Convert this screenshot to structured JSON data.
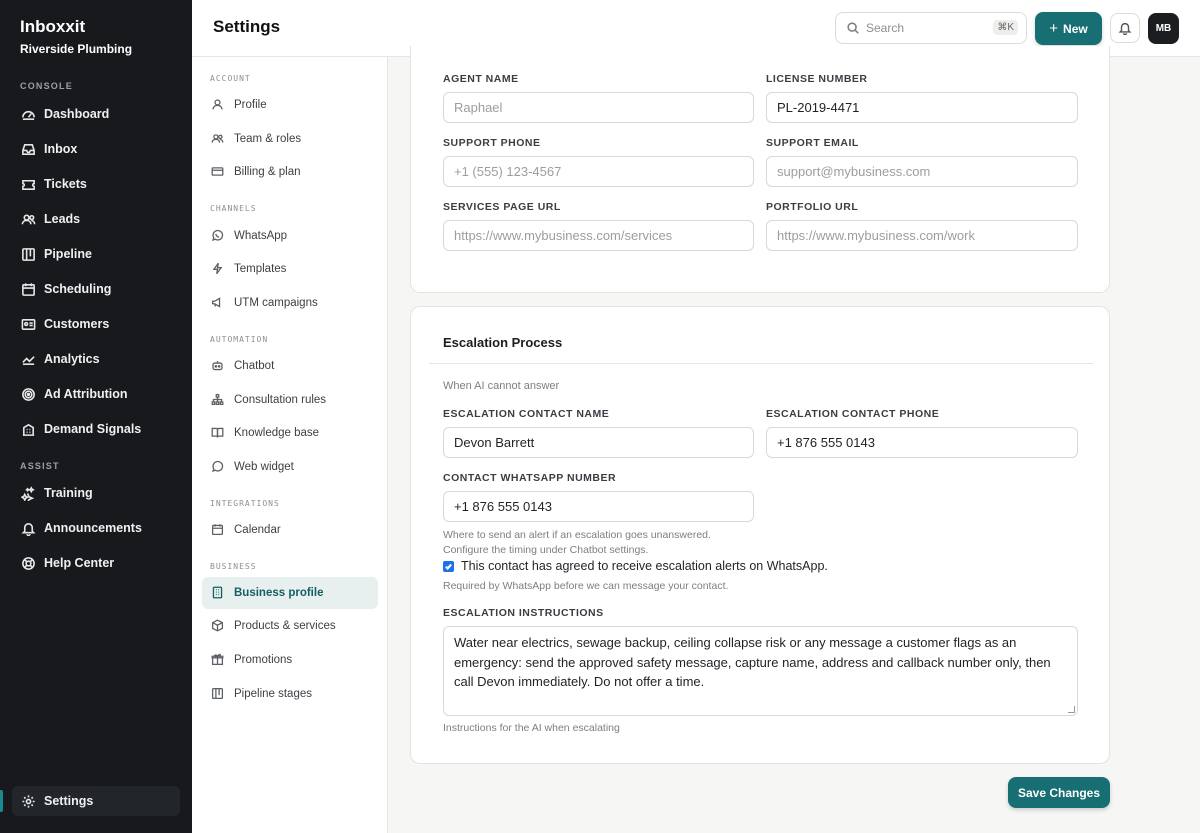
{
  "app": {
    "name": "Inboxxit",
    "workspace": "Riverside Plumbing"
  },
  "sidebar": {
    "sections": {
      "console": "CONSOLE",
      "assist": "ASSIST"
    },
    "console_items": [
      {
        "label": "Dashboard",
        "icon": "dashboard-icon"
      },
      {
        "label": "Inbox",
        "icon": "inbox-icon"
      },
      {
        "label": "Tickets",
        "icon": "ticket-icon"
      },
      {
        "label": "Leads",
        "icon": "users-icon"
      },
      {
        "label": "Pipeline",
        "icon": "pipeline-icon"
      },
      {
        "label": "Scheduling",
        "icon": "calendar-icon"
      },
      {
        "label": "Customers",
        "icon": "id-card-icon"
      },
      {
        "label": "Analytics",
        "icon": "analytics-icon"
      },
      {
        "label": "Ad Attribution",
        "icon": "target-icon"
      },
      {
        "label": "Demand Signals",
        "icon": "building-icon"
      }
    ],
    "assist_items": [
      {
        "label": "Training",
        "icon": "sparkle-icon"
      },
      {
        "label": "Announcements",
        "icon": "bell-icon"
      },
      {
        "label": "Help Center",
        "icon": "lifebuoy-icon"
      }
    ],
    "settings_label": "Settings"
  },
  "topbar": {
    "title": "Settings",
    "search_placeholder": "Search",
    "search_shortcut": "⌘K",
    "new_label": "New",
    "avatar_initials": "MB"
  },
  "settings_nav": {
    "sections": {
      "account": "ACCOUNT",
      "channels": "CHANNELS",
      "automation": "AUTOMATION",
      "integrations": "INTEGRATIONS",
      "business": "BUSINESS"
    },
    "account": [
      "Profile",
      "Team & roles",
      "Billing & plan"
    ],
    "channels": [
      "WhatsApp",
      "Templates",
      "UTM campaigns"
    ],
    "automation": [
      "Chatbot",
      "Consultation rules",
      "Knowledge base",
      "Web widget"
    ],
    "integrations": [
      "Calendar"
    ],
    "business": [
      "Business profile",
      "Products & services",
      "Promotions",
      "Pipeline stages"
    ],
    "active": "Business profile"
  },
  "profile_card": {
    "agent_name": {
      "label": "AGENT NAME",
      "value": "",
      "placeholder": "Raphael"
    },
    "license_number": {
      "label": "LICENSE NUMBER",
      "value": "PL-2019-4471"
    },
    "support_phone": {
      "label": "SUPPORT PHONE",
      "placeholder": "+1 (555) 123-4567"
    },
    "support_email": {
      "label": "SUPPORT EMAIL",
      "placeholder": "support@mybusiness.com"
    },
    "services_url": {
      "label": "SERVICES PAGE URL",
      "placeholder": "https://www.mybusiness.com/services"
    },
    "portfolio_url": {
      "label": "PORTFOLIO URL",
      "placeholder": "https://www.mybusiness.com/work"
    }
  },
  "escalation": {
    "title": "Escalation Process",
    "subtitle": "When AI cannot answer",
    "contact_name": {
      "label": "ESCALATION CONTACT NAME",
      "value": "Devon Barrett"
    },
    "contact_phone": {
      "label": "ESCALATION CONTACT PHONE",
      "value": "+1 876 555 0143"
    },
    "whatsapp_number": {
      "label": "CONTACT WHATSAPP NUMBER",
      "value": "+1 876 555 0143"
    },
    "whatsapp_hint_1": "Where to send an alert if an escalation goes unanswered.",
    "whatsapp_hint_2": "Configure the timing under Chatbot settings.",
    "consent_label": "This contact has agreed to receive escalation alerts on WhatsApp.",
    "consent_checked": true,
    "consent_hint": "Required by WhatsApp before we can message your contact.",
    "instructions": {
      "label": "ESCALATION INSTRUCTIONS",
      "value": "Water near electrics, sewage backup, ceiling collapse risk or any message a customer flags as an emergency: send the approved safety message, capture name, address and callback number only, then call Devon immediately. Do not offer a time.",
      "hint": "Instructions for the AI when escalating"
    }
  },
  "save_label": "Save Changes",
  "colors": {
    "accent": "#176e73",
    "sidebar_bg": "#17191c",
    "checkbox": "#1a73e8"
  }
}
